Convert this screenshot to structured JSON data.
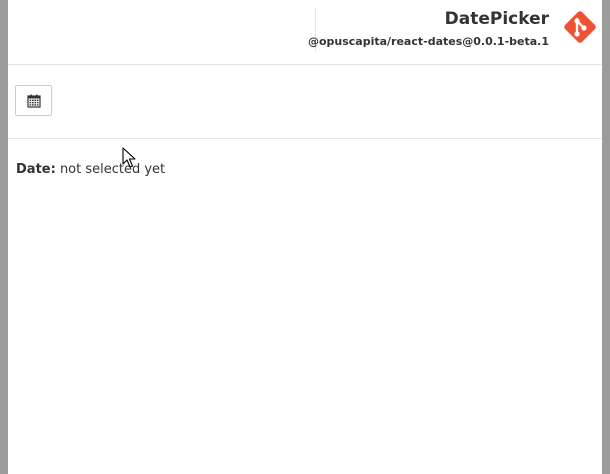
{
  "header": {
    "title": "DatePicker",
    "subtitle": "@opuscapita/react-dates@0.0.1-beta.1",
    "logo_icon": "git-icon",
    "logo_color": "#f05133"
  },
  "toolbar": {
    "calendar_button_icon": "calendar-icon"
  },
  "status": {
    "label": "Date:",
    "value": "not selected yet"
  },
  "colors": {
    "text": "#333333",
    "border": "#e5e5e5",
    "accent": "#f05133"
  }
}
